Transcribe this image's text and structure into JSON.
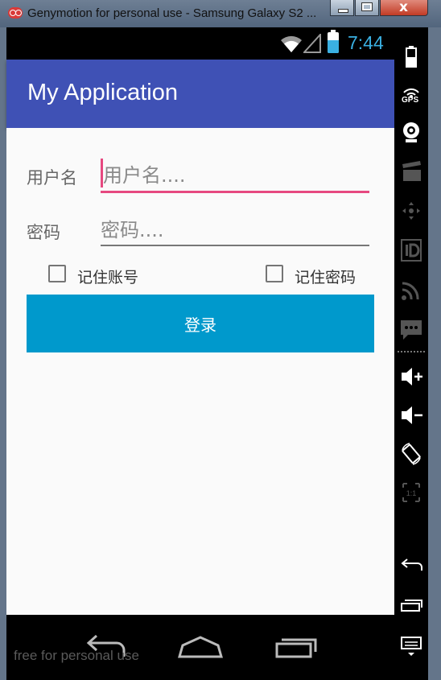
{
  "window": {
    "title": "Genymotion for personal use - Samsung Galaxy S2 ...",
    "close_label": "x"
  },
  "status_bar": {
    "time": "7:44",
    "icons": [
      "wifi-icon",
      "signal-icon",
      "battery-charging-icon"
    ]
  },
  "app_bar": {
    "title": "My Application"
  },
  "form": {
    "username": {
      "label": "用户名",
      "value": "",
      "placeholder": "用户名...."
    },
    "password": {
      "label": "密码",
      "value": "",
      "placeholder": "密码...."
    },
    "remember_account": {
      "label": "记住账号",
      "checked": false
    },
    "remember_password": {
      "label": "记住密码",
      "checked": false
    },
    "login_label": "登录"
  },
  "nav_bar": {
    "buttons": [
      "back-icon",
      "home-icon",
      "recents-icon"
    ],
    "watermark": "free for personal use"
  },
  "toolbar": {
    "items": [
      "battery-icon",
      "gps-icon",
      "webcam-icon",
      "video-capture-icon",
      "dpad-icon",
      "device-id-icon",
      "network-icon",
      "sms-icon",
      "volume-up-icon",
      "volume-down-icon",
      "rotate-icon",
      "pixel-perfect-icon",
      "back-icon",
      "recent-apps-icon",
      "menu-icon"
    ],
    "gps_label": "GPS",
    "pixel_perfect_label": "1:1"
  },
  "colors": {
    "app_bar": "#3f51b5",
    "accent": "#e64980",
    "button": "#0099cc",
    "status_time": "#3ab0e2"
  }
}
